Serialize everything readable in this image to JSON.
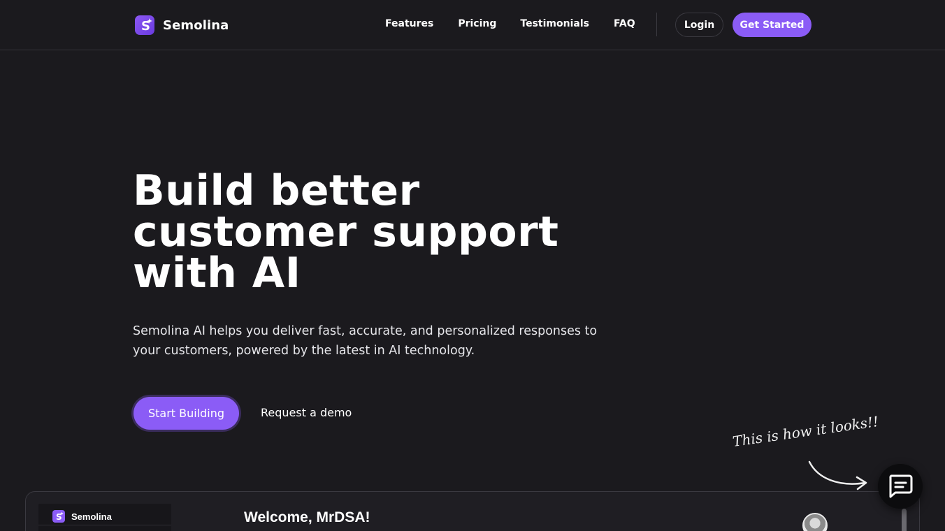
{
  "brand": {
    "name": "Semolina",
    "logo_icon": "sparkle-s-icon",
    "accent": "#8b5cf6"
  },
  "nav": {
    "links": [
      "Features",
      "Pricing",
      "Testimonials",
      "FAQ"
    ],
    "login_label": "Login",
    "cta_label": "Get Started"
  },
  "hero": {
    "title_line1": "Build better",
    "title_line2": "customer support",
    "title_line3": "with AI",
    "subtitle_line1": "Semolina AI helps you deliver fast, accurate, and personalized responses to",
    "subtitle_line2": "your customers, powered by the latest in AI technology.",
    "primary_cta": "Start Building",
    "secondary_cta": "Request a demo"
  },
  "annotation": {
    "text": "This is how it looks!!",
    "icon": "curved-arrow-icon"
  },
  "preview": {
    "brand_name": "Semolina",
    "welcome": "Welcome, MrDSA!"
  },
  "chat": {
    "icon": "chat-bubble-icon"
  },
  "colors": {
    "background": "#1b1a1e",
    "accent": "#8b5cf6",
    "text": "#ffffff"
  }
}
